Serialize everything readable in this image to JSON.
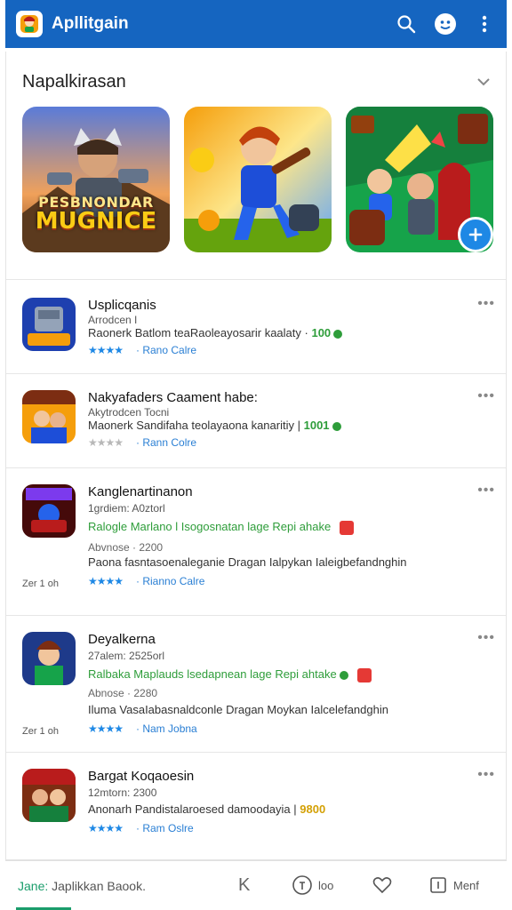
{
  "app": {
    "title": "Apllitgain"
  },
  "section": {
    "title": "Napalkirasan"
  },
  "banners": [
    {
      "line1": "PESBNONDAR",
      "line2": "MUGNICE"
    },
    {
      "line1": "",
      "line2": ""
    },
    {
      "line1": "",
      "line2": ""
    }
  ],
  "rows": [
    {
      "name": "Usplicqanis",
      "sub": "Arrodcen I",
      "desc": "Raonerk Batlom teaRaoleayosarir kaalaty ·",
      "count": "100",
      "rating_style": "blue",
      "stars": "★★★★",
      "dev": "Rano Calre"
    },
    {
      "name": "Nakyafaders Caament habe:",
      "sub": "Akytrodcen Tocni",
      "desc": "Maonerk Sandifaha teolayaona kanaritiy |",
      "count": "1001",
      "rating_style": "gray",
      "stars": "★★★★",
      "dev": "Rann Colre"
    },
    {
      "name": "Kanglenartinanon",
      "sub": "1grdiem: A0ztorl",
      "hl": "Ralogle Marlano l Isogosnatan lage Repi ahake",
      "sub2": "Abvnose · 2200",
      "desc": "Paona fasntasoenaleganie Dragan Ialpykan Ialeigbefandnghin",
      "side": "Zer 1 oh",
      "stars": "★★★★",
      "dev": "Rianno Calre"
    },
    {
      "name": "Deyalkerna",
      "sub": "27alem: 2525orl",
      "hl": "Ralbaka Maplauds lsedapnean lage Repi ahtake",
      "sub2": "Abnose · 2280",
      "desc": "Iluma VasaIabasnaldconle Dragan Moykan Ialcelefandghin",
      "side": "Zer 1 oh",
      "stars": "★★★★",
      "dev": "Nam Jobna"
    },
    {
      "name": "Bargat Koqaoesin",
      "sub": "12mtorn: 2300",
      "desc": "Anonarh Pandistalaroesed damoodayia |",
      "count": "9800",
      "stars": "★★★★",
      "dev": "Ram Oslre"
    }
  ],
  "bottom": {
    "left_prefix": "Jane:",
    "left_text": "Japlikkan Baook.",
    "k_label": "K",
    "mid_label": "loo",
    "right_label": "Menf"
  }
}
